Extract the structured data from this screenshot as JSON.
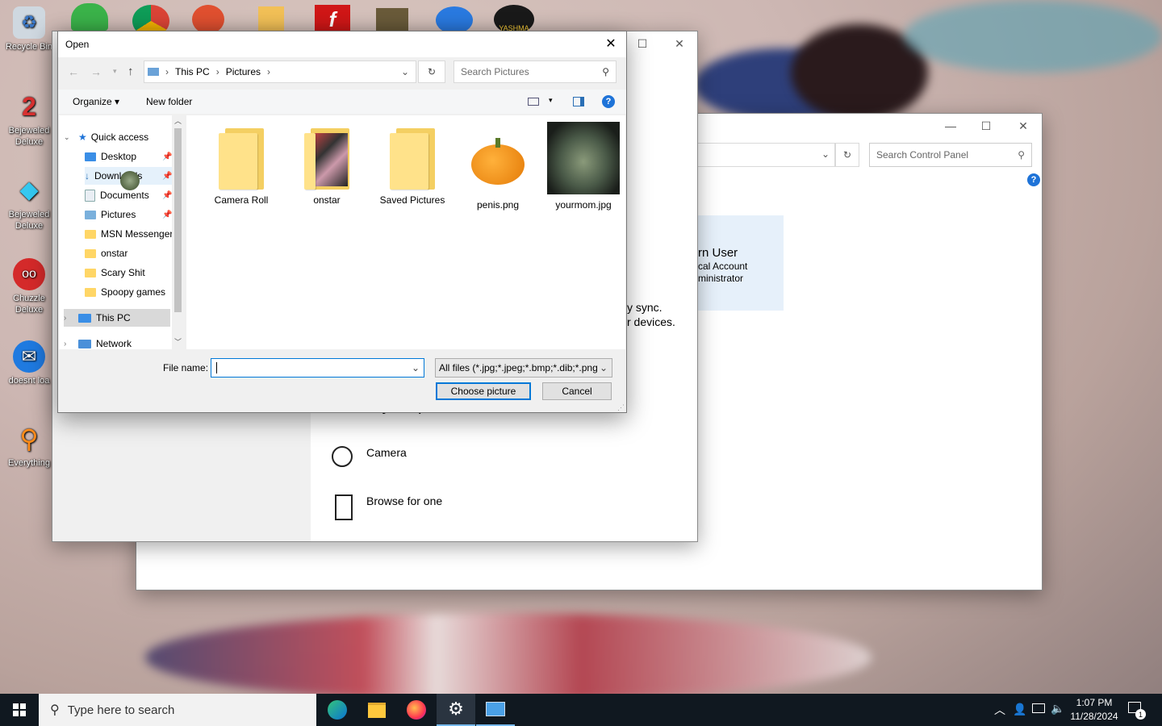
{
  "desktop": {
    "icons": [
      {
        "label": "Recycle Bin",
        "shown": "Recycle Bin"
      },
      {
        "label": "Bejeweled 2 Deluxe",
        "shown": "Bejeweled Deluxe"
      },
      {
        "label": "Bejeweled Deluxe",
        "shown": "Bejeweled Deluxe"
      },
      {
        "label": "Chuzzle Deluxe",
        "shown": "Chuzzle Deluxe"
      },
      {
        "label": "doesnt load",
        "shown": "doesnt loa"
      },
      {
        "label": "Everything",
        "shown": "Everything"
      }
    ],
    "top_icon_text": "YASHMA"
  },
  "control_panel": {
    "search_placeholder": "Search Control Panel",
    "user_name": "rn User",
    "user_type": "cal Account",
    "user_role": "ministrator"
  },
  "settings": {
    "sync_line1": "y sync.",
    "sync_line2": "r devices.",
    "create_heading": "Create your picture",
    "camera_label": "Camera",
    "browse_label": "Browse for one"
  },
  "dialog": {
    "title": "Open",
    "breadcrumb": [
      "This PC",
      "Pictures"
    ],
    "search_placeholder": "Search Pictures",
    "organize_label": "Organize",
    "new_folder_label": "New folder",
    "nav": {
      "quick_access": "Quick access",
      "items": [
        "Desktop",
        "Downloads",
        "Documents",
        "Pictures",
        "MSN Messenger",
        "onstar",
        "Scary Shit",
        "Spoopy games"
      ],
      "this_pc": "This PC",
      "network": "Network"
    },
    "files": [
      {
        "name": "Camera Roll",
        "kind": "folder"
      },
      {
        "name": "onstar",
        "kind": "folder-with-content"
      },
      {
        "name": "Saved Pictures",
        "kind": "folder"
      },
      {
        "name": "penis.png",
        "kind": "image-pumpkin"
      },
      {
        "name": "yourmom.jpg",
        "kind": "image-face"
      }
    ],
    "file_name_label": "File name:",
    "file_name_value": "",
    "file_type_value": "All files (*.jpg;*.jpeg;*.bmp;*.dib;*.png",
    "choose_label": "Choose picture",
    "cancel_label": "Cancel"
  },
  "taskbar": {
    "search_placeholder": "Type here to search",
    "time": "1:07 PM",
    "date": "11/28/2024",
    "notification_count": "1"
  }
}
